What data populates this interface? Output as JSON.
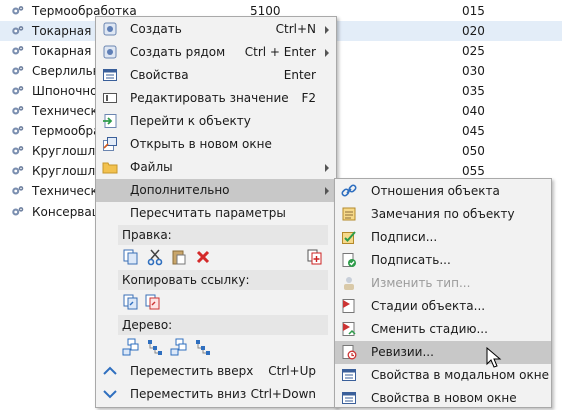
{
  "list": {
    "rows": [
      {
        "name": "Термообработка",
        "qty": "5100",
        "code": "015"
      },
      {
        "name": "Токарная",
        "qty": "",
        "code": "020"
      },
      {
        "name": "Токарная",
        "qty": "",
        "code": "025"
      },
      {
        "name": "Сверлильн",
        "qty": "",
        "code": "030"
      },
      {
        "name": "Шпоночно-",
        "qty": "",
        "code": "035"
      },
      {
        "name": "Техническ",
        "qty": "",
        "code": "040"
      },
      {
        "name": "Термообра",
        "qty": "",
        "code": "045"
      },
      {
        "name": "Круглошлис",
        "qty": "",
        "code": "050"
      },
      {
        "name": "Круглошлис",
        "qty": "",
        "code": "055"
      },
      {
        "name": "Техническ",
        "qty": "",
        "code": ""
      },
      {
        "name": "Консерваци",
        "qty": "",
        "code": ""
      }
    ]
  },
  "main_menu": {
    "create": {
      "label": "Создать",
      "shortcut": "Ctrl+N"
    },
    "create_near": {
      "label": "Создать рядом",
      "shortcut": "Ctrl + Enter"
    },
    "properties": {
      "label": "Свойства",
      "shortcut": "Enter"
    },
    "edit_value": {
      "label": "Редактировать значение",
      "shortcut": "F2"
    },
    "go_to_object": {
      "label": "Перейти к объекту"
    },
    "open_new_window": {
      "label": "Открыть в новом окне"
    },
    "files": {
      "label": "Файлы"
    },
    "additional": {
      "label": "Дополнительно"
    },
    "recalc": {
      "label": "Пересчитать параметры"
    },
    "edit_section": {
      "label": "Правка:"
    },
    "copy_link_section": {
      "label": "Копировать ссылку:"
    },
    "tree_section": {
      "label": "Дерево:"
    },
    "move_up": {
      "label": "Переместить вверх",
      "shortcut": "Ctrl+Up"
    },
    "move_down": {
      "label": "Переместить вниз",
      "shortcut": "Ctrl+Down"
    }
  },
  "sub_menu": {
    "items": [
      {
        "label": "Отношения объекта",
        "icon": "link-icon"
      },
      {
        "label": "Замечания по объекту",
        "icon": "note-icon"
      },
      {
        "label": "Подписи...",
        "icon": "signature-icon"
      },
      {
        "label": "Подписать...",
        "icon": "sign-check-icon"
      },
      {
        "label": "Изменить тип...",
        "icon": "change-type-icon"
      },
      {
        "label": "Стадии объекта...",
        "icon": "stages-icon"
      },
      {
        "label": "Сменить стадию...",
        "icon": "change-stage-icon"
      },
      {
        "label": "Ревизии...",
        "icon": "revisions-icon"
      },
      {
        "label": "Свойства в модальном окне",
        "icon": "modal-properties-icon"
      },
      {
        "label": "Свойства в новом окне",
        "icon": "window-properties-icon"
      }
    ]
  },
  "colors": {
    "hover": "#c8c8c8",
    "selected_row": "#e3edf8",
    "accent_blue": "#2f6fbf",
    "delete_red": "#d42a2a"
  }
}
